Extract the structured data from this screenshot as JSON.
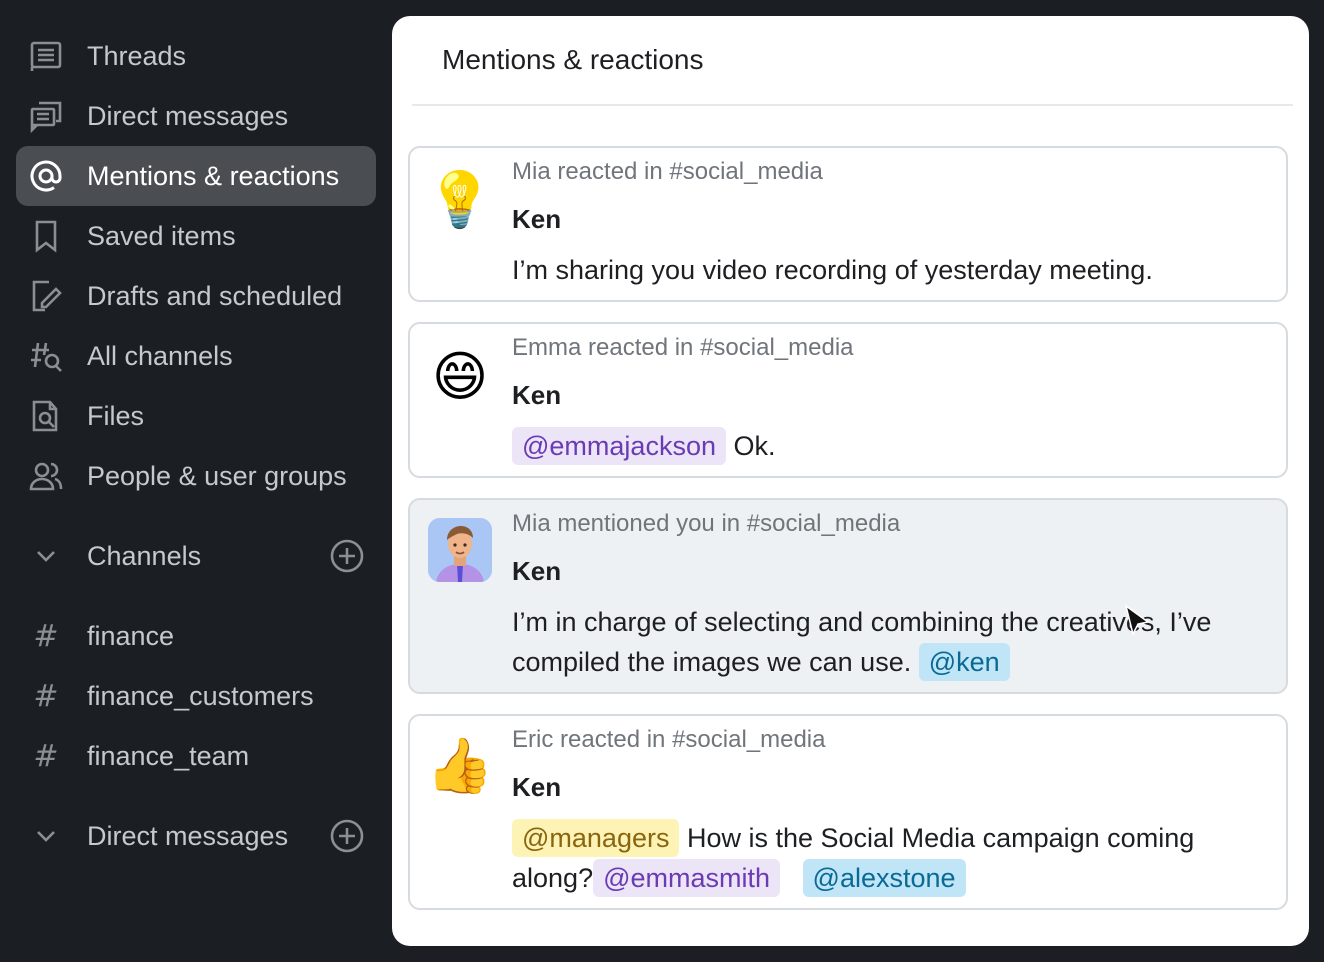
{
  "sidebar": {
    "items": [
      {
        "label": "Threads",
        "icon": "threads-icon"
      },
      {
        "label": "Direct messages",
        "icon": "direct-messages-icon"
      },
      {
        "label": "Mentions & reactions",
        "icon": "at-icon",
        "active": true
      },
      {
        "label": "Saved items",
        "icon": "bookmark-icon"
      },
      {
        "label": "Drafts and scheduled",
        "icon": "draft-edit-icon"
      },
      {
        "label": "All channels",
        "icon": "channel-search-icon"
      },
      {
        "label": "Files",
        "icon": "file-search-icon"
      },
      {
        "label": "People & user groups",
        "icon": "people-icon"
      }
    ],
    "channels_section": {
      "label": "Channels"
    },
    "channels": [
      {
        "name": "finance"
      },
      {
        "name": "finance_customers"
      },
      {
        "name": "finance_team"
      }
    ],
    "dm_section": {
      "label": "Direct messages"
    }
  },
  "main": {
    "title": "Mentions & reactions",
    "cards": [
      {
        "meta": "Mia reacted in #social_media",
        "author": "Ken",
        "avatar": "lightbulb-emoji",
        "avatar_glyph": "💡",
        "message_text": "I’m sharing you video recording of yesterday meeting."
      },
      {
        "meta": "Emma reacted in #social_media",
        "author": "Ken",
        "avatar": "grinning-emoji",
        "avatar_glyph": "😄",
        "mention": "@emmajackson",
        "message_text": " Ok."
      },
      {
        "meta": "Mia mentioned you in #social_media",
        "author": "Ken",
        "avatar": "user-avatar-icon",
        "message_text": "I’m in charge of selecting and combining the creatives, I’ve compiled the images we can use. ",
        "mention": "@ken"
      },
      {
        "meta": "Eric reacted in #social_media",
        "author": "Ken",
        "avatar": "thumbs-up-emoji",
        "avatar_glyph": "👍",
        "mention_1": "@managers",
        "message_text": " How is the Social Media campaign coming along?",
        "mention_2": "@emmasmith",
        "mention_3": "@alexstone"
      }
    ]
  },
  "colors": {
    "sidebar_bg": "#1b1f23",
    "active_bg": "#4a4e53",
    "mention_purple": "#ece4f7",
    "mention_blue": "#bfe5f7",
    "mention_yellow": "#fdf3b5"
  }
}
